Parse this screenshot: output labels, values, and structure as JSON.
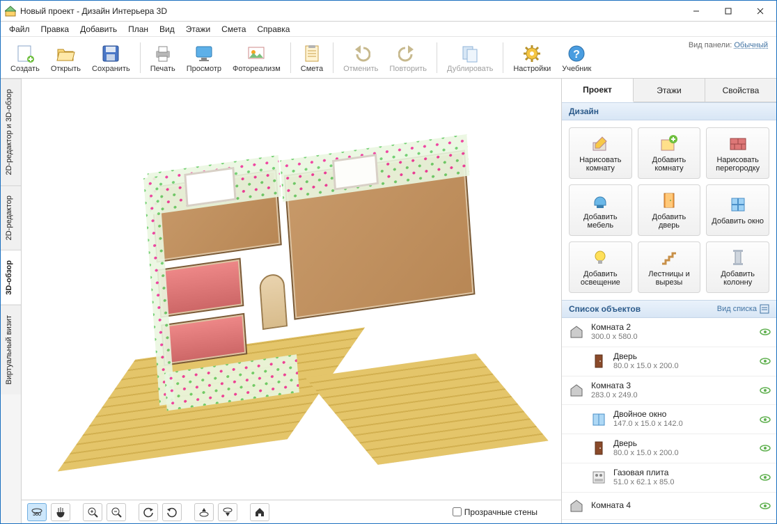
{
  "titlebar": {
    "text": "Новый проект - Дизайн Интерьера 3D"
  },
  "menu": [
    "Файл",
    "Правка",
    "Добавить",
    "План",
    "Вид",
    "Этажи",
    "Смета",
    "Справка"
  ],
  "toolbar": {
    "create": "Создать",
    "open": "Открыть",
    "save": "Сохранить",
    "print": "Печать",
    "preview": "Просмотр",
    "photo": "Фотореализм",
    "estimate": "Смета",
    "undo": "Отменить",
    "redo": "Повторить",
    "dup": "Дублировать",
    "settings": "Настройки",
    "help": "Учебник",
    "panel_label": "Вид панели:",
    "panel_mode": "Обычный"
  },
  "left_tabs": {
    "t0": "2D-редактор и 3D-обзор",
    "t1": "2D-редактор",
    "t2": "3D-обзор",
    "t3": "Виртуальный визит"
  },
  "bottom": {
    "transparent": "Прозрачные стены"
  },
  "right_tabs": {
    "project": "Проект",
    "floors": "Этажи",
    "props": "Свойства"
  },
  "design_header": "Дизайн",
  "tools": {
    "draw_room": "Нарисовать комнату",
    "add_room": "Добавить комнату",
    "draw_part": "Нарисовать перегородку",
    "add_furn": "Добавить мебель",
    "add_door": "Добавить дверь",
    "add_window": "Добавить окно",
    "add_light": "Добавить освещение",
    "stairs": "Лестницы и вырезы",
    "add_column": "Добавить колонну"
  },
  "objlist_header": "Список объектов",
  "viewlist_label": "Вид списка",
  "objects": [
    {
      "name": "Комната 2",
      "dims": "300.0 x 580.0",
      "icon": "room",
      "child": false
    },
    {
      "name": "Дверь",
      "dims": "80.0 x 15.0 x 200.0",
      "icon": "door",
      "child": true
    },
    {
      "name": "Комната 3",
      "dims": "283.0 x 249.0",
      "icon": "room",
      "child": false
    },
    {
      "name": "Двойное окно",
      "dims": "147.0 x 15.0 x 142.0",
      "icon": "window",
      "child": true
    },
    {
      "name": "Дверь",
      "dims": "80.0 x 15.0 x 200.0",
      "icon": "door",
      "child": true
    },
    {
      "name": "Газовая плита",
      "dims": "51.0 x 62.1 x 85.0",
      "icon": "stove",
      "child": true
    },
    {
      "name": "Комната 4",
      "dims": "",
      "icon": "room",
      "child": false
    }
  ]
}
